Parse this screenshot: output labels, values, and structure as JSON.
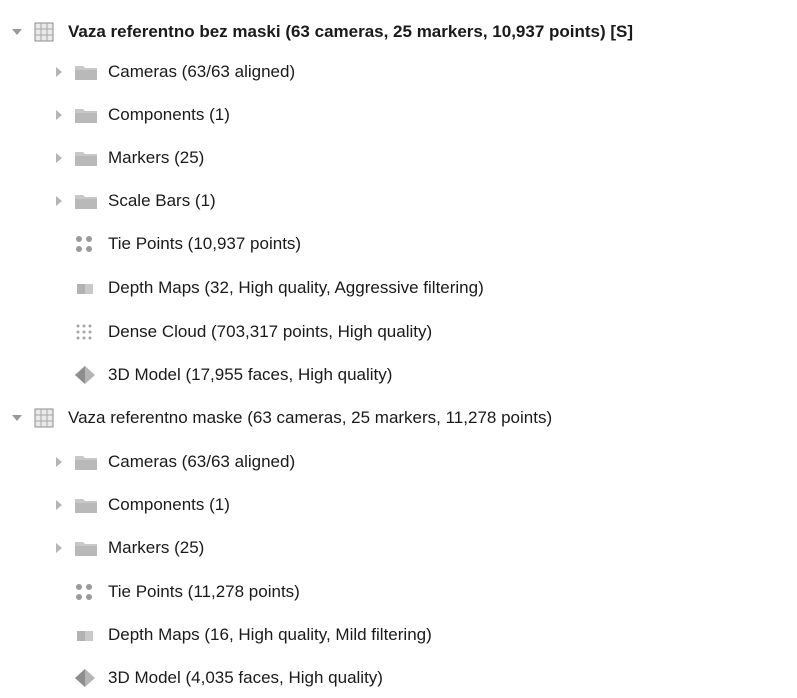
{
  "chunks": [
    {
      "label": "Vaza referentno bez maski (63 cameras, 25 markers, 10,937 points) [S]",
      "icon": "chunk-grid-icon",
      "bold": true,
      "expanded": true,
      "children": [
        {
          "label": "Cameras (63/63 aligned)",
          "icon": "folder-icon",
          "expandable": true
        },
        {
          "label": "Components (1)",
          "icon": "folder-icon",
          "expandable": true
        },
        {
          "label": "Markers (25)",
          "icon": "folder-icon",
          "expandable": true
        },
        {
          "label": "Scale Bars (1)",
          "icon": "folder-icon",
          "expandable": true
        },
        {
          "label": "Tie Points (10,937 points)",
          "icon": "tie-points-icon",
          "expandable": false
        },
        {
          "label": "Depth Maps (32, High quality, Aggressive filtering)",
          "icon": "depth-maps-icon",
          "expandable": false
        },
        {
          "label": "Dense Cloud (703,317 points, High quality)",
          "icon": "dense-cloud-icon",
          "expandable": false
        },
        {
          "label": "3D Model (17,955 faces, High quality)",
          "icon": "model-icon",
          "expandable": false
        }
      ]
    },
    {
      "label": "Vaza referentno maske (63 cameras, 25 markers, 11,278 points)",
      "icon": "chunk-grid-icon",
      "bold": false,
      "expanded": true,
      "children": [
        {
          "label": "Cameras (63/63 aligned)",
          "icon": "folder-icon",
          "expandable": true
        },
        {
          "label": "Components (1)",
          "icon": "folder-icon",
          "expandable": true
        },
        {
          "label": "Markers (25)",
          "icon": "folder-icon",
          "expandable": true
        },
        {
          "label": "Tie Points (11,278 points)",
          "icon": "tie-points-icon",
          "expandable": false
        },
        {
          "label": "Depth Maps (16, High quality, Mild filtering)",
          "icon": "depth-maps-icon",
          "expandable": false
        },
        {
          "label": "3D Model (4,035 faces, High quality)",
          "icon": "model-icon",
          "expandable": false
        }
      ]
    }
  ]
}
